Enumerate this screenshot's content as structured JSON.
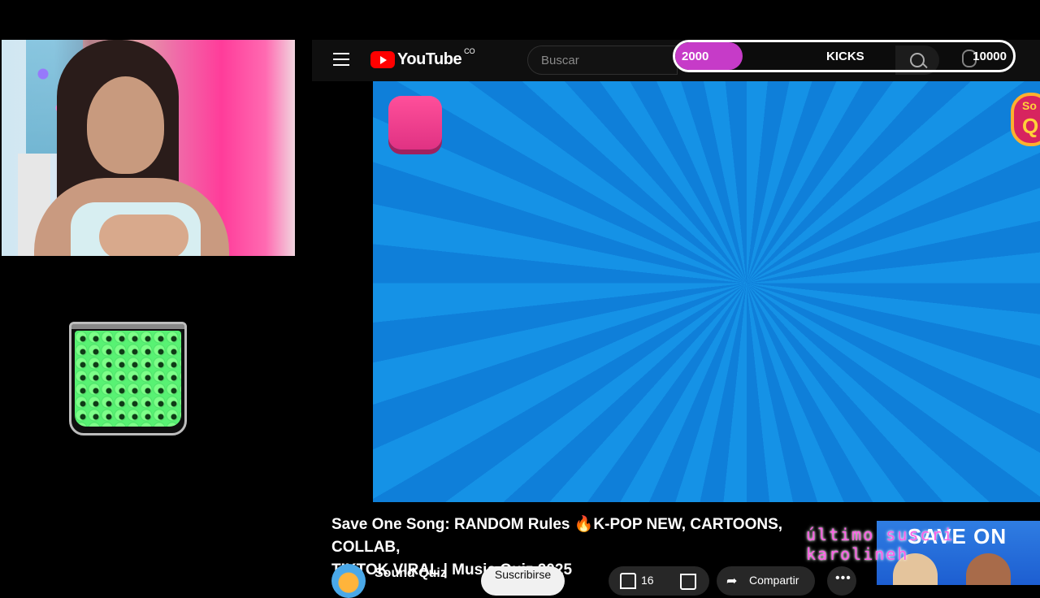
{
  "yt": {
    "logo_text": "YouTube",
    "logo_co": "CO",
    "search_placeholder": "Buscar"
  },
  "kicks_goal": {
    "current": "2000",
    "label": "KICKS",
    "goal": "10000",
    "progress_fraction": 0.2,
    "fill_color": "#c63bc8"
  },
  "video": {
    "title_line1": "Save One Song: RANDOM Rules 🔥K-POP NEW, CARTOONS, COLLAB,",
    "title_line2": "TIKTOK VIRAL | Music Quiz 2025",
    "channel_name": "Sound Quiz",
    "subscribe_label": "Suscribirse",
    "like_count": "16",
    "share_label": "Compartir",
    "more_label": "•••",
    "corner_logo_top": "So",
    "corner_logo_bottom": "Q"
  },
  "overlay": {
    "line1": "último suscri",
    "line2": "karolineh"
  },
  "thumbnail": {
    "brand_text": "SAVE ON"
  },
  "colors": {
    "accent": "#ff0000",
    "video_bg": "#1592e6",
    "overlay_text": "#ff5be7"
  }
}
